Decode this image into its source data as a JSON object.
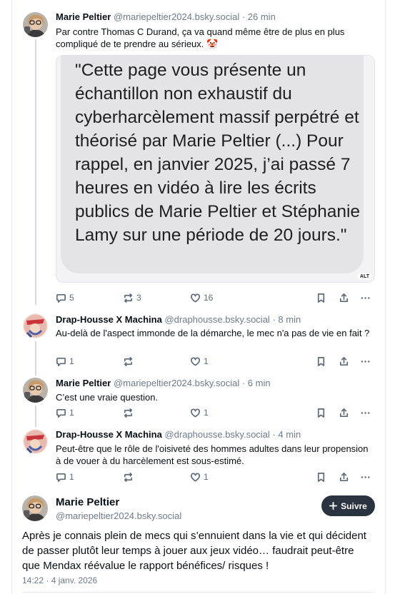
{
  "posts": [
    {
      "name": "Marie Peltier",
      "handle": "@mariepeltier2024.bsky.social",
      "time": "· 26 min",
      "text": "Par contre Thomas C Durand, ça va quand même être de plus en plus compliqué de te prendre au sérieux. 🤡",
      "quote_image_text": "\"Cette page vous présente un échantillon non exhaustif du cyberharcèlement massif perpétré et théorisé par Marie Peltier (...) Pour rappel, en janvier 2025, j’ai passé 7 heures en vidéo à lire les écrits publics de Marie Peltier et Stéphanie Lamy sur une période de 20 jours.\"",
      "alt_label": "ALT",
      "replies": "5",
      "reposts": "3",
      "likes": "16"
    },
    {
      "name": "Drap-Housse X Machina",
      "handle": "@draphousse.bsky.social",
      "time": "· 8 min",
      "text": "Au-delà de l'aspect immonde de la démarche, le mec n'a pas de vie en fait ?",
      "replies": "1",
      "reposts": "",
      "likes": "1"
    },
    {
      "name": "Marie Peltier",
      "handle": "@mariepeltier2024.bsky.social",
      "time": "· 6 min",
      "text": "C’est une vraie question.",
      "replies": "1",
      "reposts": "",
      "likes": "1"
    },
    {
      "name": "Drap-Housse X Machina",
      "handle": "@draphousse.bsky.social",
      "time": "· 4 min",
      "text": "Peut-être que le rôle de l'oisiveté des hommes adultes dans leur propension à de vouer à du harcèlement est sous-estimé.",
      "replies": "1",
      "reposts": "",
      "likes": "1"
    }
  ],
  "main_post": {
    "name": "Marie Peltier",
    "handle": "@mariepeltier2024.bsky.social",
    "follow_label": "Suivre",
    "text": "Après je connais plein de mecs qui s’ennuient dans la vie et qui décident de passer plutôt leur temps à jouer aux jeux vidéo… faudrait peut-être que Mendax réévalue le rapport bénéfices/ risques !",
    "date": "14:22 · 4 janv. 2026"
  },
  "colors": {
    "thread_line": "#d4dbe2",
    "follow_button": "#2a3340",
    "muted_text": "#6f7b88"
  },
  "icons": [
    "reply-icon",
    "repost-icon",
    "like-icon",
    "bookmark-icon",
    "share-icon",
    "more-icon",
    "plus-icon"
  ]
}
